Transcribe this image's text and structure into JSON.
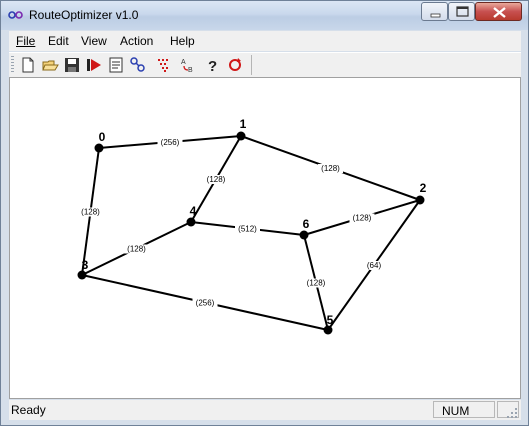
{
  "window": {
    "title": "RouteOptimizer v1.0"
  },
  "menu": [
    {
      "label": "File"
    },
    {
      "label": "Edit"
    },
    {
      "label": "View"
    },
    {
      "label": "Action"
    },
    {
      "label": "Help"
    }
  ],
  "toolbar": {
    "icons": [
      "new-file-icon",
      "open-folder-icon",
      "save-icon",
      "run-icon",
      "properties-icon",
      "route-icon",
      "grid-icon",
      "ab-icon",
      "help-icon",
      "refresh-icon"
    ]
  },
  "graph": {
    "nodes": [
      {
        "id": "0",
        "label": "0"
      },
      {
        "id": "1",
        "label": "1"
      },
      {
        "id": "2",
        "label": "2"
      },
      {
        "id": "3",
        "label": "3"
      },
      {
        "id": "4",
        "label": "4"
      },
      {
        "id": "5",
        "label": "5"
      },
      {
        "id": "6",
        "label": "6"
      }
    ],
    "edges": [
      {
        "from": "0",
        "to": "1",
        "label": "(256)"
      },
      {
        "from": "1",
        "to": "2",
        "label": "(128)"
      },
      {
        "from": "1",
        "to": "4",
        "label": "(128)"
      },
      {
        "from": "0",
        "to": "3",
        "label": "(128)"
      },
      {
        "from": "4",
        "to": "6",
        "label": "(512)"
      },
      {
        "from": "6",
        "to": "2",
        "label": "(128)"
      },
      {
        "from": "3",
        "to": "4",
        "label": "(128)"
      },
      {
        "from": "2",
        "to": "5",
        "label": "(64)"
      },
      {
        "from": "6",
        "to": "5",
        "label": "(128)"
      },
      {
        "from": "3",
        "to": "5",
        "label": "(256)"
      }
    ]
  },
  "status": {
    "ready": "Ready",
    "num": "NUM"
  }
}
